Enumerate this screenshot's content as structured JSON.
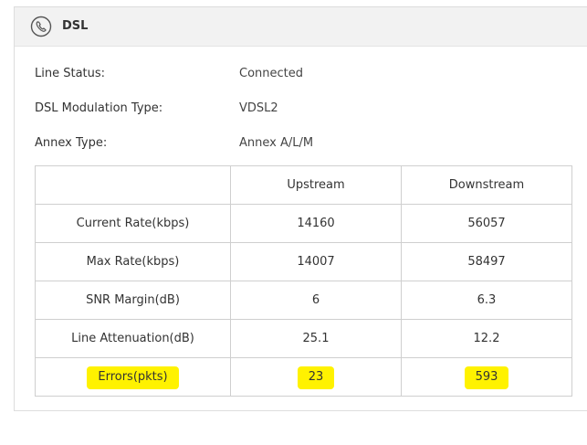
{
  "section": {
    "title": "DSL",
    "icon": "phone-icon"
  },
  "info": [
    {
      "label": "Line Status:",
      "value": "Connected"
    },
    {
      "label": "DSL Modulation Type:",
      "value": "VDSL2"
    },
    {
      "label": "Annex Type:",
      "value": "Annex A/L/M"
    }
  ],
  "table": {
    "headers": [
      "",
      "Upstream",
      "Downstream"
    ],
    "rows": [
      {
        "label": "Current Rate(kbps)",
        "upstream": "14160",
        "downstream": "56057",
        "highlighted": false
      },
      {
        "label": "Max Rate(kbps)",
        "upstream": "14007",
        "downstream": "58497",
        "highlighted": false
      },
      {
        "label": "SNR Margin(dB)",
        "upstream": "6",
        "downstream": "6.3",
        "highlighted": false
      },
      {
        "label": "Line Attenuation(dB)",
        "upstream": "25.1",
        "downstream": "12.2",
        "highlighted": false
      },
      {
        "label": "Errors(pkts)",
        "upstream": "23",
        "downstream": "593",
        "highlighted": true
      }
    ]
  },
  "colors": {
    "highlight": "#fff200",
    "header_bg": "#f2f2f2",
    "border": "#cfcfcf"
  }
}
